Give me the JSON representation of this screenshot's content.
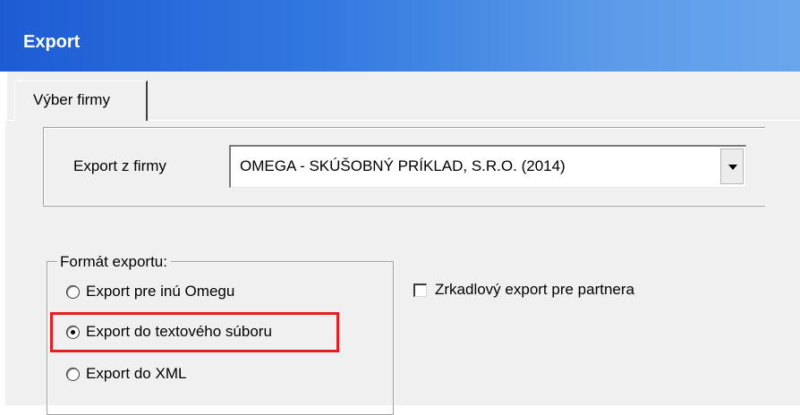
{
  "window": {
    "title": "Export"
  },
  "tabs": [
    {
      "label": "Výber firmy"
    }
  ],
  "firm": {
    "label": "Export z firmy",
    "selected": "OMEGA - SKÚŠOBNÝ PRÍKLAD, S.R.O. (2014)"
  },
  "format": {
    "legend": "Formát exportu:",
    "options": [
      {
        "label": "Export pre inú Omegu",
        "checked": false
      },
      {
        "label": "Export do textového súboru",
        "checked": true
      },
      {
        "label": "Export do XML",
        "checked": false
      }
    ]
  },
  "mirror": {
    "label": "Zrkadlový export pre partnera",
    "checked": false
  },
  "colors": {
    "titlebar_start": "#1d5bd3",
    "titlebar_end": "#6aa6ec",
    "highlight": "#e31e25",
    "dialog_bg": "#f0f0f0"
  },
  "icons": {
    "dropdown": "chevron-down-icon"
  }
}
